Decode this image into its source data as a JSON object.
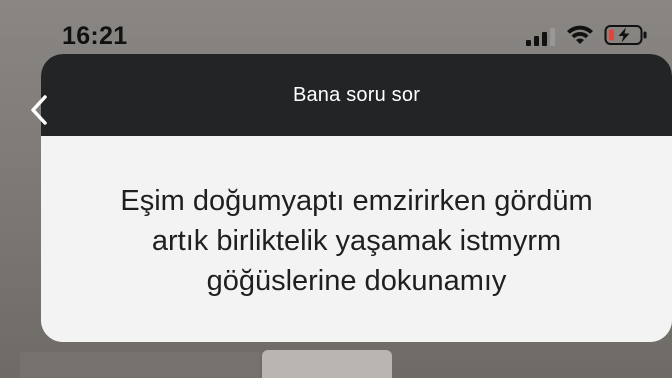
{
  "status_bar": {
    "time": "16:21"
  },
  "card": {
    "title": "Bana soru sor",
    "question_lines": [
      "Eşim doğumyaptı emzirirken gördüm",
      "artık birliktelik yaşamak istmyrm",
      "göğüslerine dokunamıy"
    ]
  },
  "icons": {
    "back": "chevron-left-icon",
    "signal": "cellular-signal-icon",
    "wifi": "wifi-icon",
    "battery": "battery-charging-icon"
  },
  "colors": {
    "header_bg": "#232426",
    "card_bg": "#f3f3f3",
    "battery_low": "#e0463b"
  }
}
